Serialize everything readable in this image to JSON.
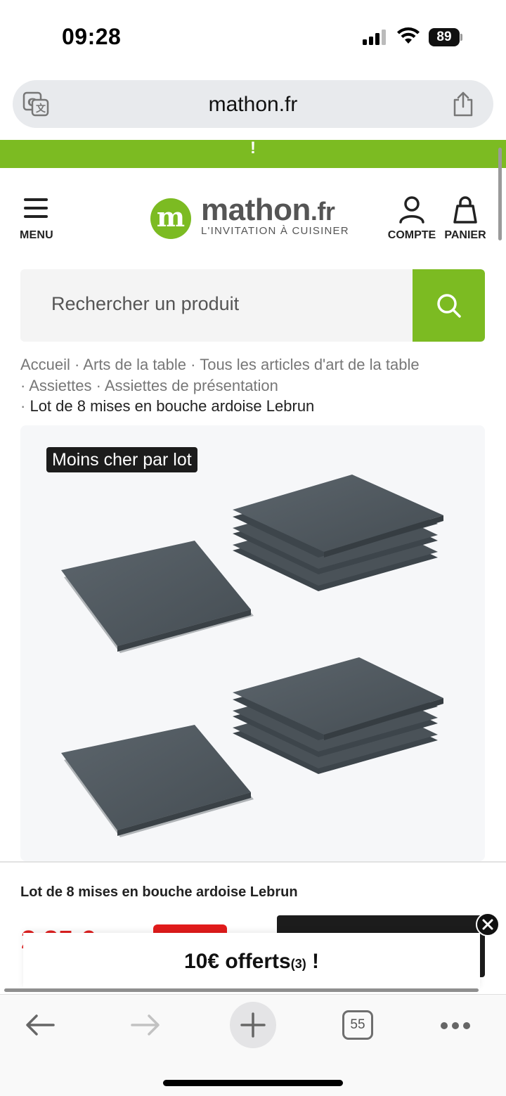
{
  "status_bar": {
    "time": "09:28",
    "battery": "89"
  },
  "browser": {
    "url": "mathon.fr",
    "tab_count": "55"
  },
  "banner": {
    "text": "!"
  },
  "header": {
    "menu_label": "MENU",
    "logo_name": "mathon",
    "logo_suffix": ".fr",
    "logo_tagline": "L'INVITATION À CUISINER",
    "account_label": "COMPTE",
    "cart_label": "PANIER"
  },
  "search": {
    "placeholder": "Rechercher un produit"
  },
  "breadcrumb": {
    "items": [
      "Accueil",
      "Arts de la table",
      "Tous les articles d'art de la table",
      "Assiettes",
      "Assiettes de présentation",
      "Lot de 8 mises en bouche ardoise Lebrun"
    ],
    "separator": "·"
  },
  "product": {
    "badge": "Moins cher par lot",
    "sticky_title": "Lot de 8 mises en bouche ardoise Lebrun",
    "price_fragment": "2  85 €"
  },
  "offer": {
    "text": "10€ offerts",
    "sup": "(3)",
    "suffix": " !"
  },
  "colors": {
    "brand_green": "#7cbb22",
    "price_red": "#e02020",
    "dark": "#1c1c1c"
  },
  "icons": [
    "translate-icon",
    "share-icon",
    "hamburger-icon",
    "user-icon",
    "bag-icon",
    "search-icon",
    "close-icon",
    "back-arrow-icon",
    "forward-arrow-icon",
    "plus-icon",
    "tabs-icon",
    "more-icon"
  ]
}
